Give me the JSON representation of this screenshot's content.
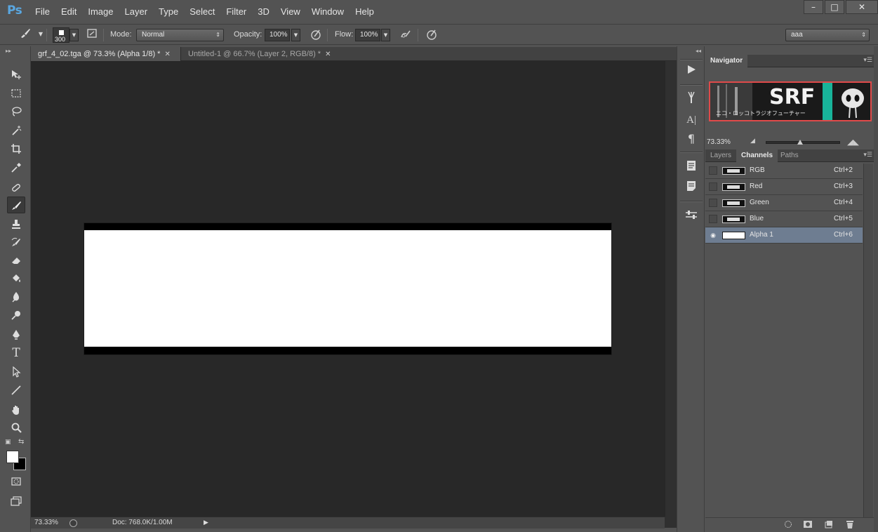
{
  "app": {
    "logo": "Ps"
  },
  "menu": [
    "File",
    "Edit",
    "Image",
    "Layer",
    "Type",
    "Select",
    "Filter",
    "3D",
    "View",
    "Window",
    "Help"
  ],
  "window_controls": {
    "minimize": "–",
    "maximize": "□",
    "close": "✕"
  },
  "options": {
    "brush_size": "300",
    "mode_label": "Mode:",
    "mode_value": "Normal",
    "opacity_label": "Opacity:",
    "opacity_value": "100%",
    "flow_label": "Flow:",
    "flow_value": "100%",
    "workspace_value": "aaa"
  },
  "tabs": [
    {
      "label": "grf_4_02.tga @ 73.3% (Alpha 1/8) *",
      "active": true
    },
    {
      "label": "Untitled-1 @ 66.7% (Layer 2, RGB/8) *",
      "active": false
    }
  ],
  "status": {
    "zoom": "73.33%",
    "doc": "Doc: 768.0K/1.00M"
  },
  "navigator": {
    "title": "Navigator",
    "zoom": "73.33%",
    "thumb_text": "SRF",
    "thumb_subtext": "ニコ・ロッコトラジオフューチャー"
  },
  "channels_panel": {
    "tabs": [
      "Layers",
      "Channels",
      "Paths"
    ],
    "active_tab": "Channels",
    "rows": [
      {
        "name": "RGB",
        "shortcut": "Ctrl+2",
        "selected": false,
        "visible": false
      },
      {
        "name": "Red",
        "shortcut": "Ctrl+3",
        "selected": false,
        "visible": false
      },
      {
        "name": "Green",
        "shortcut": "Ctrl+4",
        "selected": false,
        "visible": false
      },
      {
        "name": "Blue",
        "shortcut": "Ctrl+5",
        "selected": false,
        "visible": false
      },
      {
        "name": "Alpha 1",
        "shortcut": "Ctrl+6",
        "selected": true,
        "visible": true
      }
    ]
  },
  "colors": {
    "ui_bg": "#535353",
    "canvas_bg": "#282828",
    "selection": "#6e7d91",
    "logo_blue": "#5aa7e0",
    "nav_frame": "#e04a4a",
    "foreground": "#ffffff",
    "background": "#000000"
  },
  "icons": {
    "toolbar": [
      "move-icon",
      "marquee-icon",
      "lasso-icon",
      "magic-wand-icon",
      "crop-icon",
      "eyedropper-icon",
      "healing-brush-icon",
      "brush-icon",
      "clone-stamp-icon",
      "history-brush-icon",
      "eraser-icon",
      "paint-bucket-icon",
      "blur-icon",
      "dodge-icon",
      "pen-icon",
      "type-icon",
      "path-selection-icon",
      "line-icon",
      "hand-icon",
      "zoom-icon"
    ]
  }
}
